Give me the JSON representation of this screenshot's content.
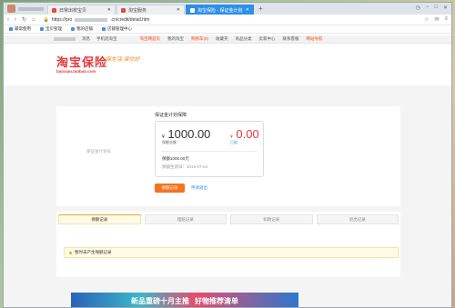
{
  "browser": {
    "tabs": [
      {
        "label": "日常出校宝贝",
        "active": false
      },
      {
        "label": "淘宝服务",
        "active": false
      },
      {
        "label": "淘宝保险 - 保证金计划",
        "active": true
      }
    ],
    "url": "https://prod.████████.com/credit/detail.htm",
    "url_prefix": "https://pro",
    "url_suffix": ".cn/credit/detail.htm",
    "bookmarks": [
      "最常使用",
      "宝贝管理",
      "我的店铺",
      "店铺管理中心"
    ]
  },
  "site_nav": {
    "items": [
      "消息",
      "手机逛淘宝"
    ],
    "home": "淘宝网首页",
    "right": [
      "我的淘宝",
      "购物车(0)",
      "收藏夹",
      "商品分类",
      "卖家中心",
      "联系客服",
      "网站导航"
    ]
  },
  "header": {
    "logo": "淘宝保险",
    "slogan": "保生活 保你好",
    "sub": "baoxian.taobao.com"
  },
  "insurance": {
    "product_id": "保证金计划号",
    "title": "保证金计划保障",
    "amount": "1000.00",
    "amount_label": "保额金额",
    "currency": "¥",
    "claim_amount": "0.00",
    "claim_label": "已赔",
    "line1": "保额1000.00元",
    "line2": "保额生效日：2019-07-24",
    "primary_button": "保额记录",
    "link_button": "申请退出"
  },
  "records": {
    "tabs": [
      "保额记录",
      "理赔记录",
      "扣款记录",
      "退出记录"
    ],
    "notice": "暂时未产生保额记录"
  },
  "banner": {
    "text1": "新品重磅十月主推",
    "text2": "好物推荐清单"
  },
  "colors": {
    "accent": "#2f8fe8",
    "brand_red": "#e4393c",
    "orange": "#f5731f"
  }
}
